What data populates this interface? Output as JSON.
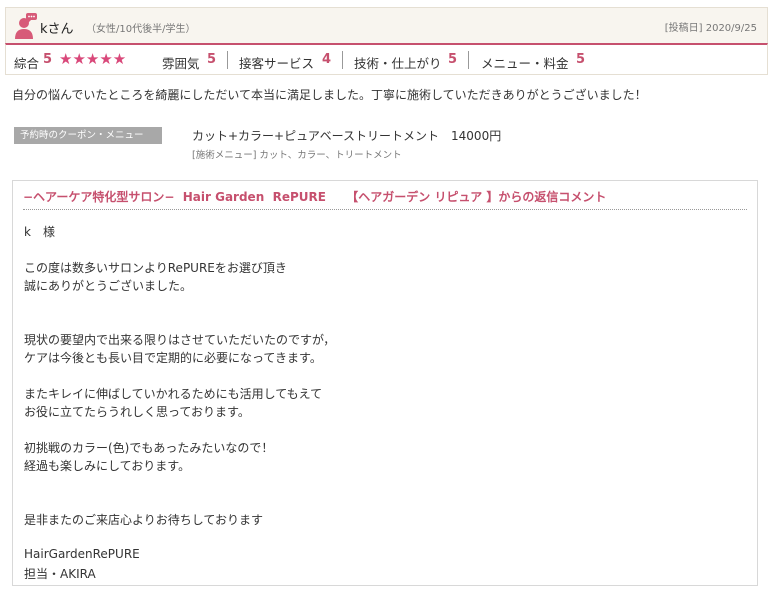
{
  "review": {
    "username": "kさん",
    "user_info": "（女性/10代後半/学生）",
    "posted_date": "[投稿日] 2020/9/25",
    "ratings": {
      "overall_label": "綜合",
      "overall_score": "5",
      "stars": "★★★★★",
      "items": [
        {
          "label": "雰囲気",
          "score": "5"
        },
        {
          "label": "接客サービス",
          "score": "4"
        },
        {
          "label": "技術・仕上がり",
          "score": "5"
        },
        {
          "label": "メニュー・料金",
          "score": "5"
        }
      ]
    },
    "body": "自分の悩んでいたところを綺麗にしただいて本当に満足しました。丁寧に施術していただきありがとうございました！",
    "coupon": {
      "badge": "予約時のクーポン・メニュー",
      "name": "カット+カラー+ピュアベーストリートメント　14000円",
      "detail": "[施術メニュー] カット、カラー、トリートメント"
    }
  },
  "reply": {
    "title": "−ヘアーケア特化型サロン−  Hair Garden  RePURE 　 【ヘアガーデン リピュア 】からの返信コメント",
    "lines": [
      "k　様",
      "この度は数多いサロンよりRePUREをお選び頂き",
      "誠にありがとうございました。",
      "現状の要望内で出来る限りはさせていただいたのですが，",
      "ケアは今後とも長い目で定期的に必要になってきます。",
      "またキレイに伸ばしていかれるためにも活用してもえて",
      "お役に立てたらうれしく思っております。",
      "初挑戦のカラー(色)でもあったみたいなので！",
      "経過も楽しみにしております。",
      "是非またのご来店心よりお待ちしております",
      "HairGardenRePURE",
      "担当・AKIRA"
    ]
  },
  "colors": {
    "accent": "#c6506e",
    "star": "#d9487a",
    "header_bg": "#f8f5ef",
    "badge_bg": "#a8a8a8"
  }
}
